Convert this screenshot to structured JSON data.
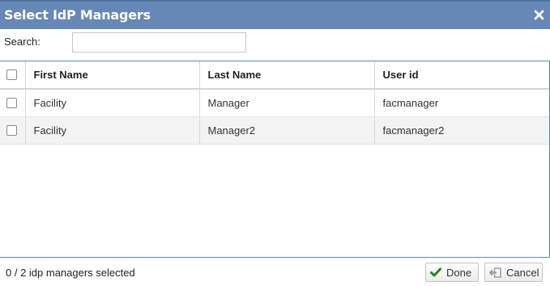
{
  "dialog": {
    "title": "Select IdP Managers"
  },
  "search": {
    "label": "Search:",
    "value": "",
    "placeholder": ""
  },
  "table": {
    "columns": [
      "First Name",
      "Last Name",
      "User id"
    ],
    "rows": [
      {
        "first_name": "Facility",
        "last_name": "Manager",
        "user_id": "facmanager",
        "selected": false
      },
      {
        "first_name": "Facility",
        "last_name": "Manager2",
        "user_id": "facmanager2",
        "selected": false
      }
    ]
  },
  "footer": {
    "status": "0 / 2 idp managers selected",
    "done_label": "Done",
    "cancel_label": "Cancel"
  },
  "icons": {
    "close": "close-icon",
    "done": "checkmark-icon",
    "cancel": "cancel-icon"
  },
  "colors": {
    "titlebar": "#6787b7",
    "table_border": "#5b8ca7",
    "done_check": "#1f8a1f",
    "alt_row": "#f3f3f3"
  }
}
